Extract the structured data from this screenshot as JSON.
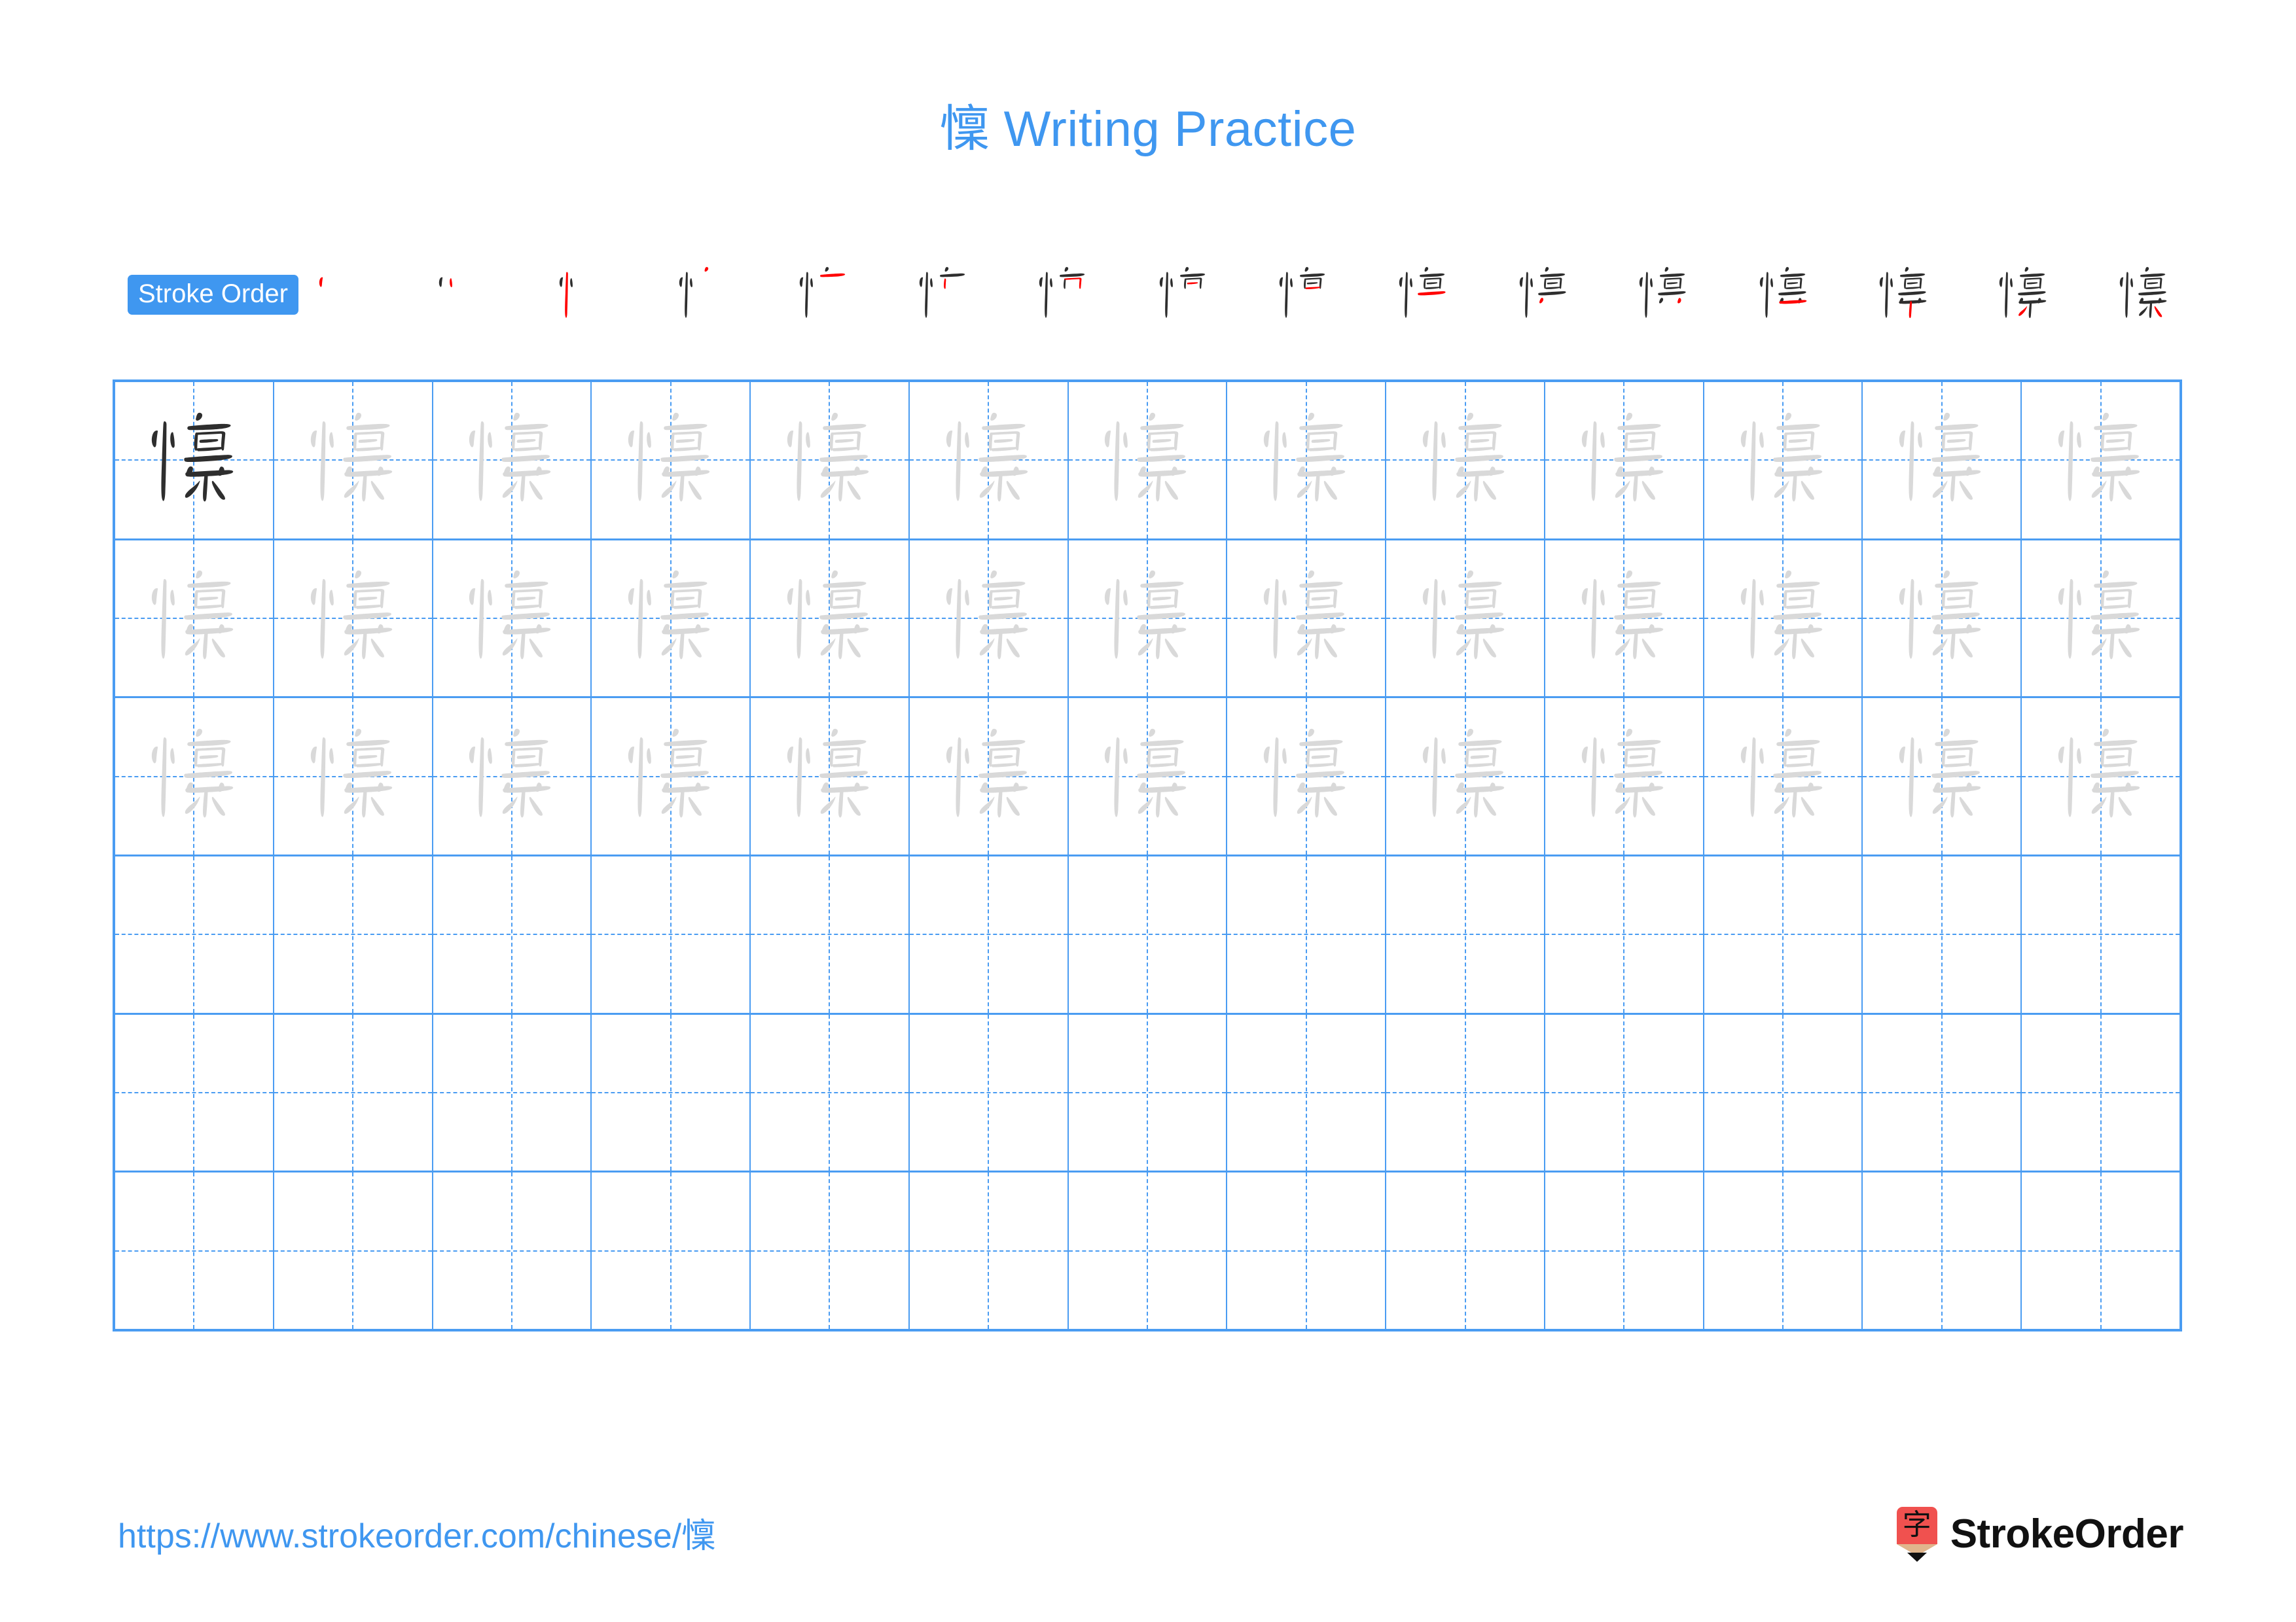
{
  "page": {
    "character": "懍",
    "title_suffix": " Writing Practice",
    "title_full": "懍 Writing Practice",
    "accent_color": "#3f97f0",
    "grid_line_color": "#4a9cf2",
    "highlight_stroke_color": "#ff0000",
    "ink_color": "#2e2e2e",
    "trace_color": "#d9d9d9",
    "brand_mark_color": "#f0514f"
  },
  "stroke_order": {
    "badge_label": "Stroke Order",
    "total_strokes": 16,
    "steps": [
      {
        "index": 1,
        "strokes_drawn": 1
      },
      {
        "index": 2,
        "strokes_drawn": 2
      },
      {
        "index": 3,
        "strokes_drawn": 3
      },
      {
        "index": 4,
        "strokes_drawn": 4
      },
      {
        "index": 5,
        "strokes_drawn": 5
      },
      {
        "index": 6,
        "strokes_drawn": 6
      },
      {
        "index": 7,
        "strokes_drawn": 7
      },
      {
        "index": 8,
        "strokes_drawn": 8
      },
      {
        "index": 9,
        "strokes_drawn": 9
      },
      {
        "index": 10,
        "strokes_drawn": 10
      },
      {
        "index": 11,
        "strokes_drawn": 11
      },
      {
        "index": 12,
        "strokes_drawn": 12
      },
      {
        "index": 13,
        "strokes_drawn": 13
      },
      {
        "index": 14,
        "strokes_drawn": 14
      },
      {
        "index": 15,
        "strokes_drawn": 15
      },
      {
        "index": 16,
        "strokes_drawn": 16
      }
    ]
  },
  "practice_grid": {
    "columns": 13,
    "rows": 6,
    "rows_detail": [
      {
        "row": 1,
        "fill": "trace",
        "first_cell": "model",
        "character": "懍"
      },
      {
        "row": 2,
        "fill": "trace",
        "character": "懍"
      },
      {
        "row": 3,
        "fill": "trace",
        "character": "懍"
      },
      {
        "row": 4,
        "fill": "blank",
        "character": ""
      },
      {
        "row": 5,
        "fill": "blank",
        "character": ""
      },
      {
        "row": 6,
        "fill": "blank",
        "character": ""
      }
    ]
  },
  "footer": {
    "url": "https://www.strokeorder.com/chinese/懍",
    "brand_name": "StrokeOrder",
    "brand_mark_glyph": "字"
  }
}
